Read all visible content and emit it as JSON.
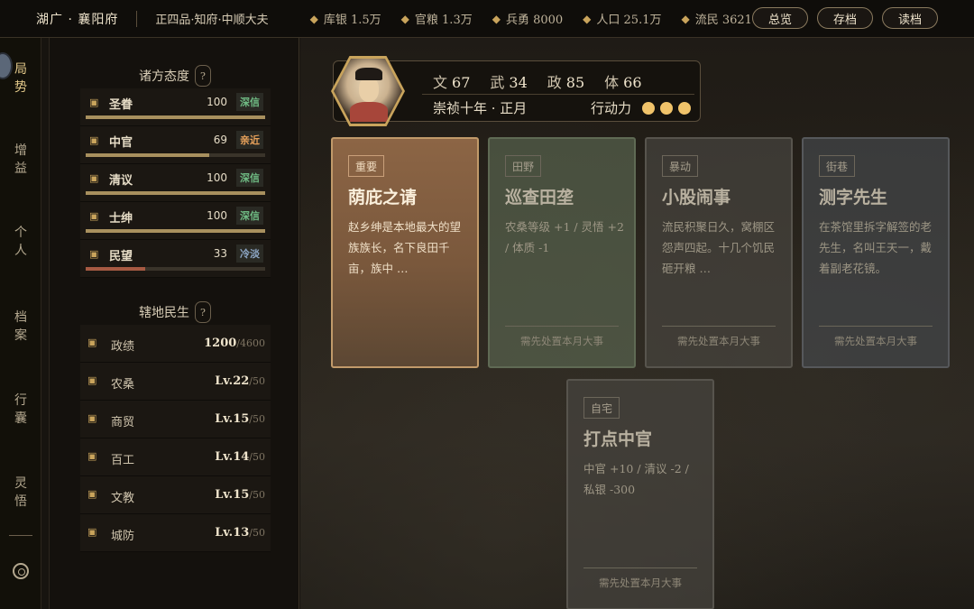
{
  "topbar": {
    "location": "湖广 · 襄阳府",
    "rank": "正四品·知府·中顺大夫",
    "stats": [
      {
        "icon": "treasury-icon",
        "label": "库银 1.5万"
      },
      {
        "icon": "grain-icon",
        "label": "官粮 1.3万"
      },
      {
        "icon": "soldier-icon",
        "label": "兵勇 8000"
      },
      {
        "icon": "population-icon",
        "label": "人口 25.1万"
      },
      {
        "icon": "refugee-icon",
        "label": "流民 3621"
      }
    ],
    "buttons": {
      "overview": "总览",
      "save": "存档",
      "load": "读档"
    }
  },
  "nav": {
    "items": [
      {
        "chars": [
          "局",
          "势"
        ],
        "active": true
      },
      {
        "chars": [
          "增",
          "益"
        ],
        "active": false
      },
      {
        "chars": [
          "个",
          "人"
        ],
        "active": false
      },
      {
        "chars": [
          "档",
          "案"
        ],
        "active": false
      },
      {
        "chars": [
          "行",
          "囊"
        ],
        "active": false
      },
      {
        "chars": [
          "灵",
          "悟"
        ],
        "active": false
      }
    ]
  },
  "attitudes": {
    "title": "诸方态度",
    "help": "?",
    "rows": [
      {
        "icon": "edict-icon",
        "name": "圣眷",
        "value": 100,
        "tag": "深信",
        "tag_color": "#6fba83",
        "fill": 1.0
      },
      {
        "icon": "eunuch-icon",
        "name": "中官",
        "value": 69,
        "tag": "亲近",
        "tag_color": "#e7a15a",
        "fill": 0.69
      },
      {
        "icon": "scholar-icon",
        "name": "清议",
        "value": 100,
        "tag": "深信",
        "tag_color": "#6fba83",
        "fill": 1.0
      },
      {
        "icon": "gentry-icon",
        "name": "士绅",
        "value": 100,
        "tag": "深信",
        "tag_color": "#6fba83",
        "fill": 1.0
      },
      {
        "icon": "people-icon",
        "name": "民望",
        "value": 33,
        "tag": "冷淡",
        "tag_color": "#8ea7c6",
        "fill": 0.33
      }
    ]
  },
  "livelihood": {
    "title": "辖地民生",
    "help": "?",
    "rows": [
      {
        "icon": "merit-icon",
        "name": "政绩",
        "value": "1200",
        "max": "/4600"
      },
      {
        "icon": "farming-icon",
        "name": "农桑",
        "value": "Lv.22",
        "max": "/50"
      },
      {
        "icon": "trade-icon",
        "name": "商贸",
        "value": "Lv.15",
        "max": "/50"
      },
      {
        "icon": "craft-icon",
        "name": "百工",
        "value": "Lv.14",
        "max": "/50"
      },
      {
        "icon": "education-icon",
        "name": "文教",
        "value": "Lv.15",
        "max": "/50"
      },
      {
        "icon": "defense-icon",
        "name": "城防",
        "value": "Lv.13",
        "max": "/50"
      }
    ]
  },
  "profile": {
    "stats": [
      {
        "label": "文",
        "value": "67"
      },
      {
        "label": "武",
        "value": "34"
      },
      {
        "label": "政",
        "value": "85"
      },
      {
        "label": "体",
        "value": "66"
      }
    ],
    "date": "崇祯十年 · 正月",
    "action_label": "行动力",
    "action_points": 3
  },
  "cards": [
    {
      "tag": "重要",
      "title": "荫庇之请",
      "desc": "赵乡绅是本地最大的望族族长，名下良田千亩，族中 …",
      "footer": "",
      "style": "active"
    },
    {
      "tag": "田野",
      "title": "巡查田垄",
      "desc": "农桑等级 +1 / 灵悟 +2 / 体质 -1",
      "footer": "需先处置本月大事",
      "style": "green"
    },
    {
      "tag": "暴动",
      "title": "小股闹事",
      "desc": "流民积聚日久，窝棚区怨声四起。十几个饥民砸开粮 …",
      "footer": "需先处置本月大事",
      "style": "grey"
    },
    {
      "tag": "街巷",
      "title": "测字先生",
      "desc": "在茶馆里拆字解签的老先生，名叫王天一，戴着副老花镜。",
      "footer": "需先处置本月大事",
      "style": "slate"
    },
    {
      "tag": "自宅",
      "title": "打点中官",
      "desc": "中官 +10 / 清议 -2 / 私银 -300",
      "footer": "需先处置本月大事",
      "style": "grey"
    }
  ]
}
